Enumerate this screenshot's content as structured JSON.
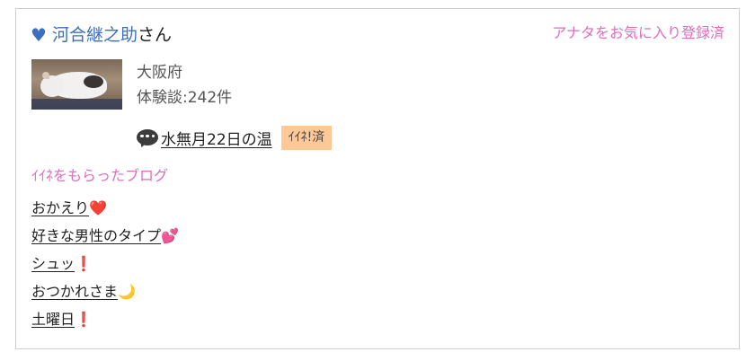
{
  "user": {
    "heart_icon": "♥",
    "name": "河合継之助",
    "suffix": "さん",
    "favorite_status": "アナタをお気に入り登録済"
  },
  "profile": {
    "region": "大阪府",
    "review_count": "体験談:242件"
  },
  "latest_post": {
    "title": "水無月22日の温",
    "like_badge": "ｲｲﾈ!済"
  },
  "liked_blogs": {
    "title": "ｲｲﾈをもらったブログ",
    "items": [
      {
        "label": "おかえり",
        "emoji": "❤️"
      },
      {
        "label": "好きな男性のタイプ",
        "emoji": "💕"
      },
      {
        "label": "シュッ",
        "emoji": "❗"
      },
      {
        "label": "おつかれさま",
        "emoji": "🌙"
      },
      {
        "label": "土曜日",
        "emoji": "❗"
      }
    ]
  },
  "colors": {
    "user_blue": "#3d6fbf",
    "pink_accent": "#e06bbf",
    "badge_orange": "#ffc896"
  }
}
